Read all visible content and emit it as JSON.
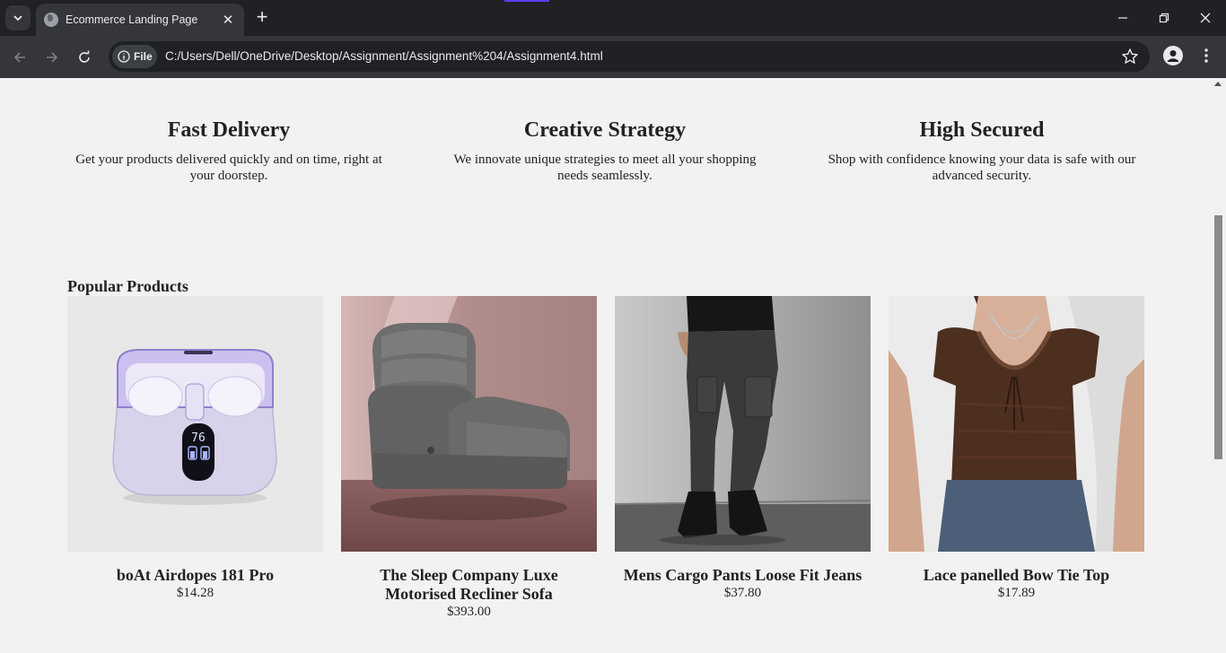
{
  "browser": {
    "tab_title": "Ecommerce Landing Page",
    "chip_label": "File",
    "url": "C:/Users/Dell/OneDrive/Desktop/Assignment/Assignment%204/Assignment4.html"
  },
  "features": [
    {
      "title": "Fast Delivery",
      "text": "Get your products delivered quickly and on time, right at your doorstep."
    },
    {
      "title": "Creative Strategy",
      "text": "We innovate unique strategies to meet all your shopping needs seamlessly."
    },
    {
      "title": "High Secured",
      "text": "Shop with confidence knowing your data is safe with our advanced security."
    }
  ],
  "popular": {
    "title": "Popular Products",
    "products": [
      {
        "name": "boAt Airdopes 181 Pro",
        "price": "$14.28",
        "case_display": "76"
      },
      {
        "name": "The Sleep Company Luxe Motorised Recliner Sofa",
        "price": "$393.00"
      },
      {
        "name": "Mens Cargo Pants Loose Fit Jeans",
        "price": "$37.80"
      },
      {
        "name": "Lace panelled Bow Tie Top",
        "price": "$17.89"
      }
    ]
  }
}
